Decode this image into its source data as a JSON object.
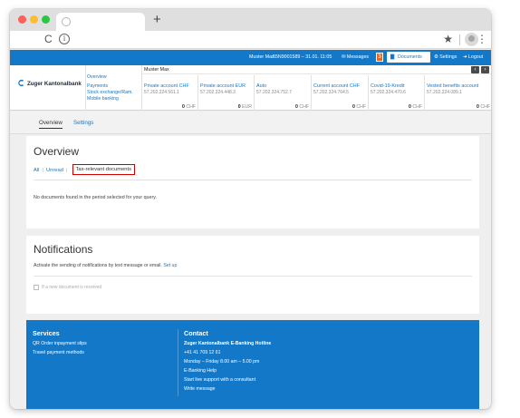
{
  "browser": {
    "new_tab": "+",
    "reload": "C",
    "info": "i",
    "star": "★",
    "menu": "⋮"
  },
  "userbar": {
    "user": "Muster Max",
    "session": "55N9001589 – 31.01. 11:05",
    "messages": "Messages",
    "message_count": "3",
    "documents": "Documents",
    "settings": "Settings",
    "logout": "Logout"
  },
  "bank": {
    "name": "Zuger Kantonalbank",
    "nav": [
      "Overview",
      "Payments",
      "Stock exchange/Ram.",
      "Mobile banking"
    ]
  },
  "accounts": {
    "owner": "Muster Max",
    "items": [
      {
        "name": "Private account CHF",
        "number": "57.202.324.561.1",
        "amount": "0",
        "currency": "CHF"
      },
      {
        "name": "Private account EUR",
        "number": "57.202.324.448.3",
        "amount": "0",
        "currency": "EUR"
      },
      {
        "name": "Auto",
        "number": "57.202.324.752.7",
        "amount": "0",
        "currency": "CHF"
      },
      {
        "name": "Current account CHF",
        "number": "57.202.324.764.5",
        "amount": "0",
        "currency": "CHF"
      },
      {
        "name": "Covid-19-Kredit",
        "number": "57.202.324.470.6",
        "amount": "0",
        "currency": "CHF"
      },
      {
        "name": "Vested benefits account",
        "number": "57.202.324.089.1",
        "amount": "0",
        "currency": "CHF"
      }
    ]
  },
  "tabs": {
    "overview": "Overview",
    "settings": "Settings"
  },
  "overview": {
    "title": "Overview",
    "filter_all": "All",
    "filter_unread": "Unread",
    "filter_sep": "|",
    "filter_tax": "Tax-relevant documents",
    "empty": "No documents found in the period selected for your query."
  },
  "notifications": {
    "title": "Notifications",
    "desc": "Activate the sending of notifications by text message or email.",
    "setup": "Set up",
    "checkbox": "If a new document is received"
  },
  "footer": {
    "services_title": "Services",
    "services": [
      "QR Order inpayment slips",
      "Travel payment methods"
    ],
    "contact_title": "Contact",
    "contact": [
      "Zuger Kantonalbank E-Banking Hotline",
      "+41 41 709 12 61",
      "Monday – Friday 8.00 am – 5.00 pm",
      "E-Banking Help",
      "Start live support with a consultant",
      "Write message"
    ]
  },
  "colors": {
    "brand_blue": "#1478c8",
    "badge_orange": "#e8651d",
    "highlight_red": "#cc0000"
  }
}
